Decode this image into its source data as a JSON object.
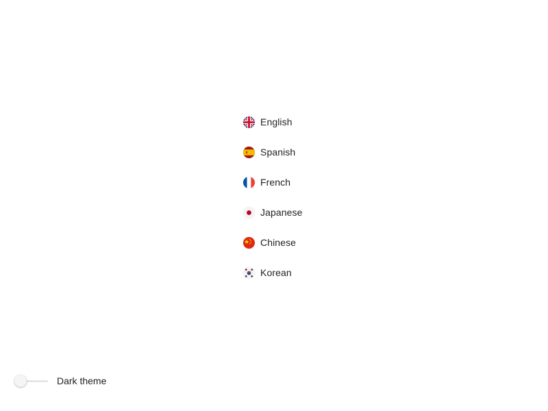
{
  "languages": [
    {
      "label": "English",
      "icon": "uk-flag-icon"
    },
    {
      "label": "Spanish",
      "icon": "spain-flag-icon"
    },
    {
      "label": "French",
      "icon": "france-flag-icon"
    },
    {
      "label": "Japanese",
      "icon": "japan-flag-icon"
    },
    {
      "label": "Chinese",
      "icon": "china-flag-icon"
    },
    {
      "label": "Korean",
      "icon": "korea-flag-icon"
    }
  ],
  "theme_toggle": {
    "label": "Dark theme",
    "checked": false
  },
  "colors": {
    "background": "#ffffff",
    "text": "#1f1f1f",
    "track": "#e6e6e6",
    "knob": "#f5f5f5"
  }
}
